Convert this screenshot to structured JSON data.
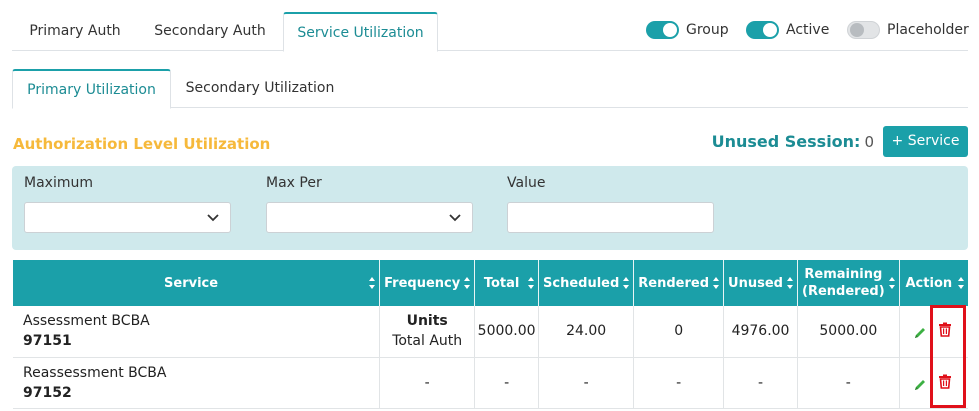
{
  "top_tabs": [
    "Primary Auth",
    "Secondary Auth",
    "Service Utilization"
  ],
  "toggles": [
    {
      "label": "Group",
      "state": "on"
    },
    {
      "label": "Active",
      "state": "on"
    },
    {
      "label": "Placeholder",
      "state": "off"
    }
  ],
  "sub_tabs": [
    "Primary Utilization",
    "Secondary Utilization"
  ],
  "section_title": "Authorization Level Utilization",
  "unused_session": {
    "label": "Unused Session:",
    "value": "0"
  },
  "add_service_label": "+ Service",
  "filters": {
    "maximum_label": "Maximum",
    "max_per_label": "Max Per",
    "value_label": "Value",
    "maximum_value": "",
    "max_per_value": "",
    "value_value": ""
  },
  "table": {
    "headers": [
      "Service",
      "Frequency",
      "Total",
      "Scheduled",
      "Rendered",
      "Unused",
      "Remaining (Rendered)",
      "Action"
    ],
    "rows": [
      {
        "service_name": "Assessment BCBA",
        "service_code": "97151",
        "frequency_units": "Units",
        "frequency_sub": "Total Auth",
        "total": "5000.00",
        "scheduled": "24.00",
        "rendered": "0",
        "unused": "4976.00",
        "remaining": "5000.00"
      },
      {
        "service_name": "Reassessment BCBA",
        "service_code": "97152",
        "frequency_units": "",
        "frequency_sub": "-",
        "total": "-",
        "scheduled": "-",
        "rendered": "-",
        "unused": "-",
        "remaining": "-"
      }
    ]
  },
  "colors": {
    "accent": "#1ba0a9",
    "title": "#f6b93b",
    "panel": "#cfe9ec",
    "highlight": "#e0101a"
  },
  "icons": [
    "chevron-down-icon",
    "sort-icon",
    "pencil-icon",
    "trash-icon"
  ]
}
